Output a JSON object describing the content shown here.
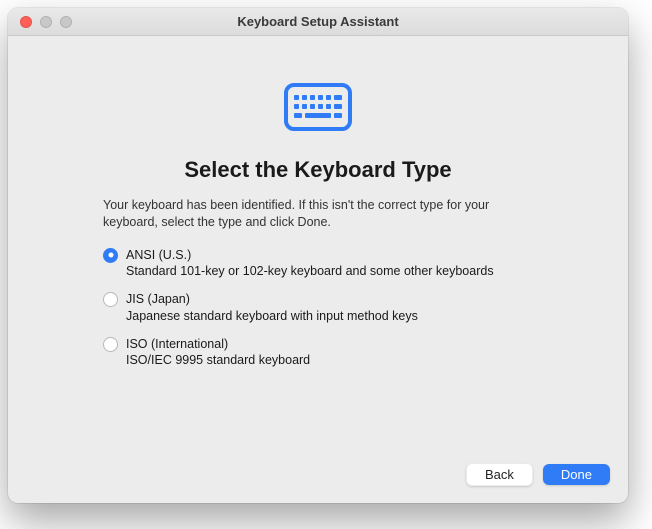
{
  "window": {
    "title": "Keyboard Setup Assistant"
  },
  "main": {
    "heading": "Select the Keyboard Type",
    "description": "Your keyboard has been identified. If this isn't the correct type for your keyboard, select the type and click Done."
  },
  "options": [
    {
      "label": "ANSI (U.S.)",
      "sublabel": "Standard 101-key or 102-key keyboard and some other keyboards",
      "selected": true
    },
    {
      "label": "JIS (Japan)",
      "sublabel": "Japanese standard keyboard with input method keys",
      "selected": false
    },
    {
      "label": "ISO (International)",
      "sublabel": "ISO/IEC 9995 standard keyboard",
      "selected": false
    }
  ],
  "buttons": {
    "back": "Back",
    "done": "Done"
  },
  "icon": "keyboard-icon",
  "colors": {
    "accent": "#2f7cf6"
  }
}
